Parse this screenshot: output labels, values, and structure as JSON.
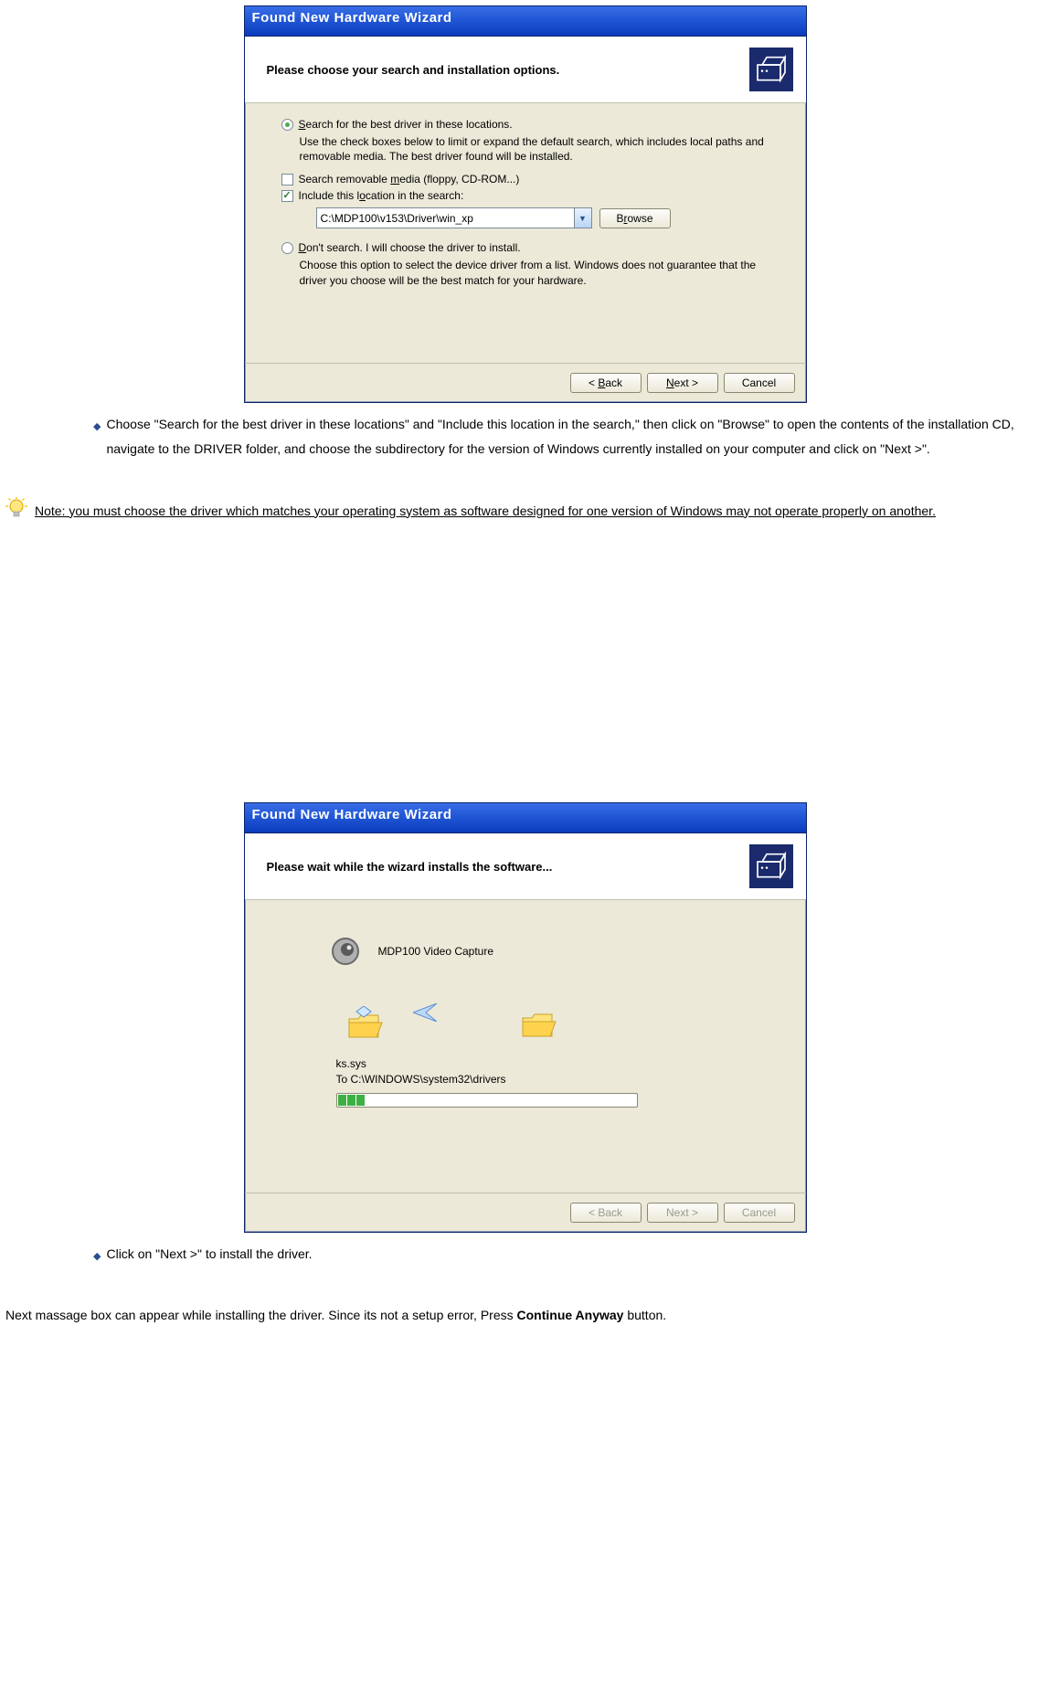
{
  "window1": {
    "title": "Found New Hardware Wizard",
    "header": "Please choose your search and installation options.",
    "radio_search": "Search for the best driver in these locations.",
    "radio_search_u": "S",
    "search_desc": "Use the check boxes below to limit or expand the default search, which includes local paths and removable media. The best driver found will be installed.",
    "chk_removable": "Search removable media (floppy, CD-ROM...)",
    "chk_removable_u": "m",
    "chk_include": "Include this location in the search:",
    "chk_include_u": "o",
    "path_value": "C:\\MDP100\\v153\\Driver\\win_xp",
    "browse_label": "Browse",
    "browse_u": "r",
    "radio_dont": "Don't search. I will choose the driver to install.",
    "radio_dont_u": "D",
    "dont_desc": "Choose this option to select the device driver from a list.  Windows does not guarantee that the driver you choose will be the best match for your hardware.",
    "back_label": "< Back",
    "back_u": "B",
    "next_label": "Next >",
    "next_u": "N",
    "cancel_label": "Cancel"
  },
  "para1": "Choose \"Search for the best driver in these locations\" and \"Include this location in the search,\" then click on \"Browse\" to open the contents of the installation CD, navigate to the DRIVER folder, and choose the subdirectory for the version of Windows currently installed on your computer and click on \"Next >\".",
  "note": "Note: you must choose the driver which matches your operating system as software designed for one version of Windows may not operate properly on another.",
  "window2": {
    "title": "Found New Hardware Wizard",
    "header": "Please wait while the wizard installs the software...",
    "device_name": "MDP100 Video Capture",
    "file_name": "ks.sys",
    "file_dest": "To C:\\WINDOWS\\system32\\drivers",
    "back_label": "< Back",
    "next_label": "Next >",
    "cancel_label": "Cancel"
  },
  "para2": "Click on \"Next >\" to install the driver.",
  "para3_pre": "Next massage box can appear while installing the driver. Since its not a setup error, Press ",
  "para3_bold": "Continue Anyway",
  "para3_post": " button."
}
